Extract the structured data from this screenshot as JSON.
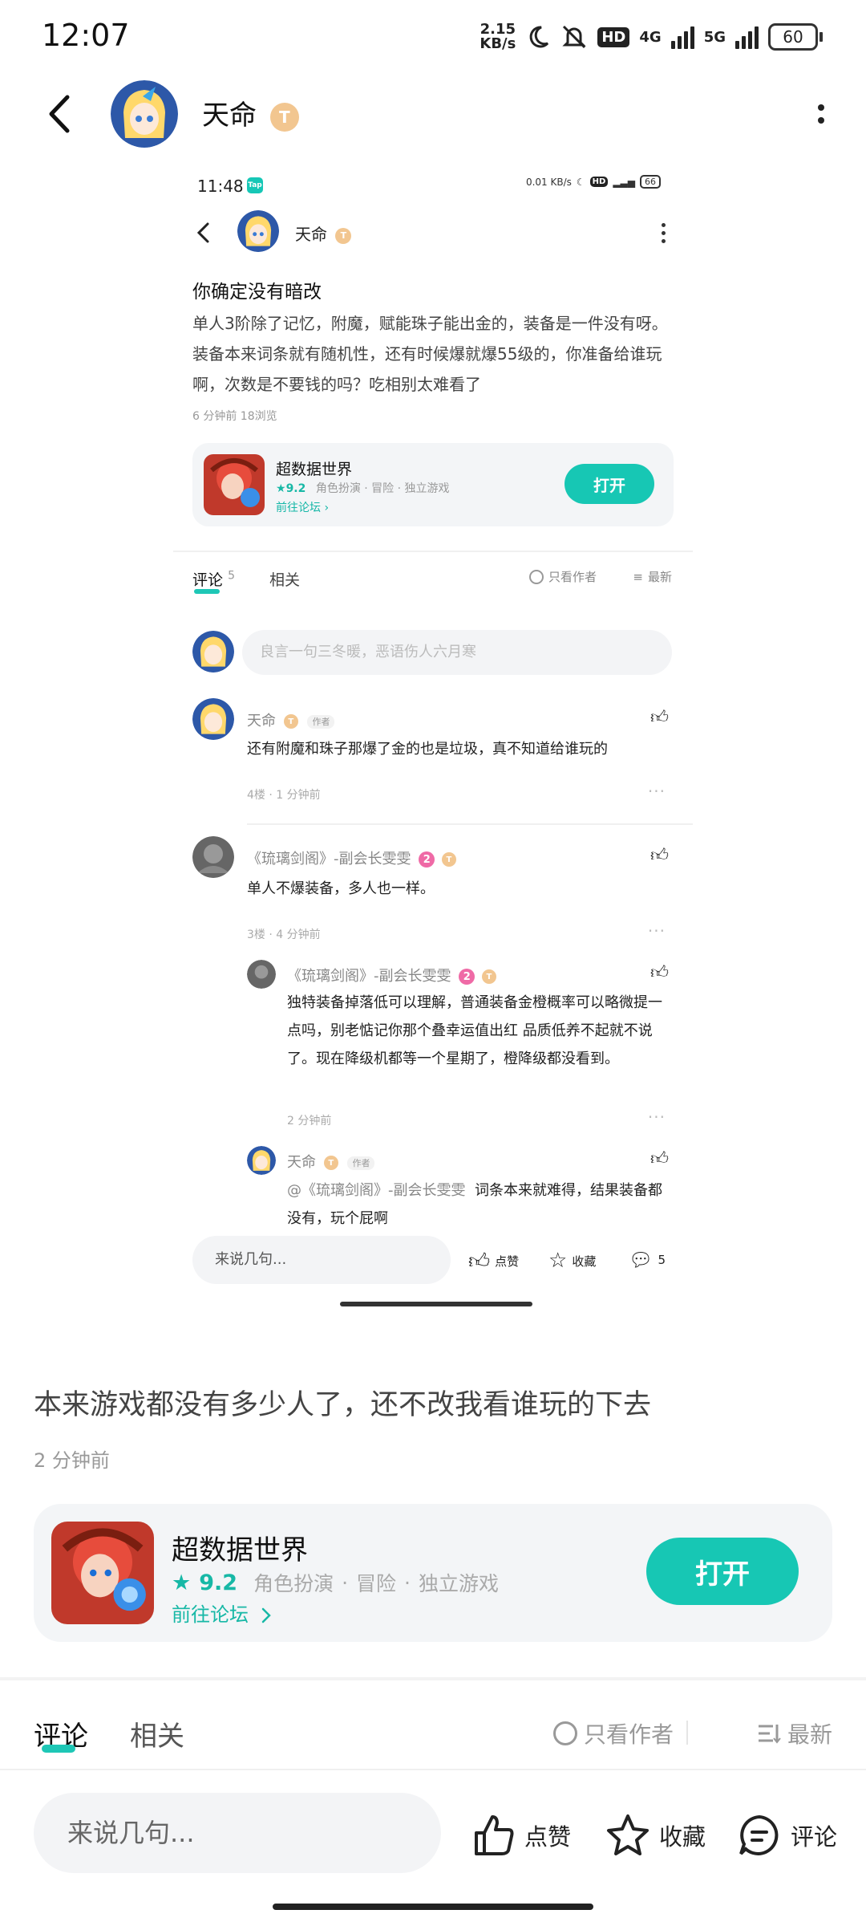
{
  "status_bar": {
    "time": "12:07",
    "speed_top": "2.15",
    "speed_unit": "KB/s",
    "hd": "HD",
    "net1": "4G",
    "net2": "5G",
    "battery": "60"
  },
  "header": {
    "name": "天命",
    "badge": "T"
  },
  "screenshot": {
    "status_time": "11:48",
    "status_speed": "0.01 KB/s",
    "status_battery": "66",
    "app_icon_text": "Tap",
    "name": "天命",
    "badge": "T",
    "post_title": "你确定没有暗改",
    "post_body": "单人3阶除了记忆，附魔，赋能珠子能出金的，装备是一件没有呀。装备本来词条就有随机性，还有时候爆就爆55级的，你准备给谁玩啊，次数是不要钱的吗？吃相别太难看了",
    "post_meta": "6 分钟前  18浏览",
    "game_card": {
      "name": "超数据世界",
      "rating": "9.2",
      "tags": "角色扮演 · 冒险 · 独立游戏",
      "forum_link": "前往论坛",
      "open_button": "打开"
    },
    "tabs": {
      "comment": "评论",
      "comment_count": "5",
      "related": "相关",
      "only_author": "只看作者",
      "sort": "最新"
    },
    "comment_placeholder": "良言一句三冬暖，恶语伤人六月寒",
    "comments": [
      {
        "name": "天命",
        "author_tag": "作者",
        "text": "还有附魔和珠子那爆了金的也是垃圾，真不知道给谁玩的",
        "meta": "4楼 · 1 分钟前"
      },
      {
        "name": "《琉璃剑阁》-副会长雯雯",
        "level": "2",
        "text": "单人不爆装备，多人也一样。",
        "meta": "3楼 · 4 分钟前"
      }
    ],
    "replies": [
      {
        "name": "《琉璃剑阁》-副会长雯雯",
        "level": "2",
        "text": "独特装备掉落低可以理解，普通装备金橙概率可以略微提一点吗，别老惦记你那个叠幸运值出红 品质低养不起就不说了。现在降级机都等一个星期了，橙降级都没看到。",
        "meta": "2 分钟前"
      },
      {
        "name": "天命",
        "author_tag": "作者",
        "mention": "@《琉璃剑阁》-副会长雯雯",
        "text": "词条本来就难得，结果装备都没有，玩个屁啊"
      }
    ],
    "bottom_bar": {
      "input": "来说几句...",
      "like": "点赞",
      "collect": "收藏",
      "comment_count": "5"
    }
  },
  "main": {
    "comment_text": "本来游戏都没有多少人了，还不改我看谁玩的下去",
    "time": "2 分钟前",
    "game_card": {
      "name": "超数据世界",
      "rating": "9.2",
      "tag1": "角色扮演",
      "tag2": "冒险",
      "tag3": "独立游戏",
      "forum_link": "前往论坛",
      "open_button": "打开"
    },
    "tabs": {
      "comment": "评论",
      "related": "相关",
      "only_author": "只看作者",
      "sort": "最新"
    },
    "bottom_bar": {
      "input": "来说几句...",
      "like": "点赞",
      "collect": "收藏",
      "comment": "评论"
    }
  },
  "colors": {
    "accent": "#17c7b4",
    "link": "#17b8a6",
    "badge": "#f2c690",
    "level": "#ef6aa6"
  }
}
